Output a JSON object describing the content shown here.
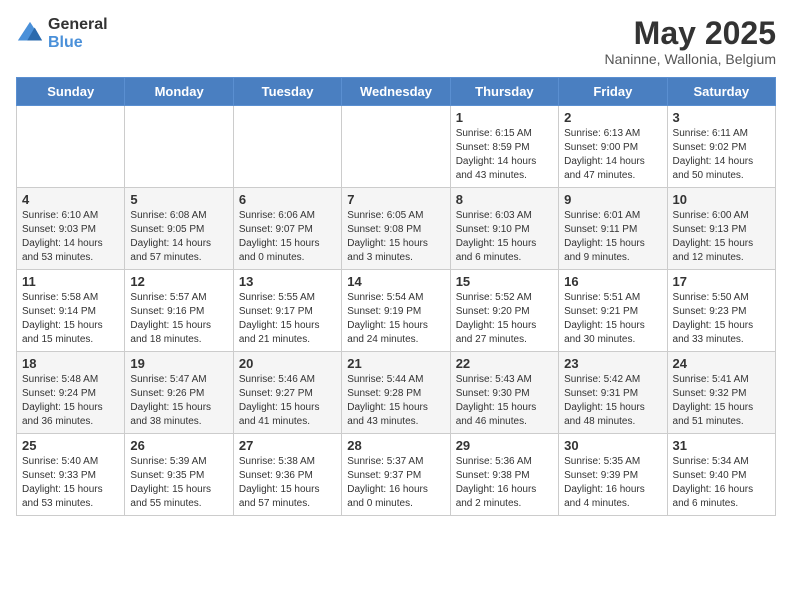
{
  "header": {
    "logo_general": "General",
    "logo_blue": "Blue",
    "title": "May 2025",
    "subtitle": "Naninne, Wallonia, Belgium"
  },
  "days_of_week": [
    "Sunday",
    "Monday",
    "Tuesday",
    "Wednesday",
    "Thursday",
    "Friday",
    "Saturday"
  ],
  "weeks": [
    [
      {
        "day": "",
        "info": ""
      },
      {
        "day": "",
        "info": ""
      },
      {
        "day": "",
        "info": ""
      },
      {
        "day": "",
        "info": ""
      },
      {
        "day": "1",
        "info": "Sunrise: 6:15 AM\nSunset: 8:59 PM\nDaylight: 14 hours\nand 43 minutes."
      },
      {
        "day": "2",
        "info": "Sunrise: 6:13 AM\nSunset: 9:00 PM\nDaylight: 14 hours\nand 47 minutes."
      },
      {
        "day": "3",
        "info": "Sunrise: 6:11 AM\nSunset: 9:02 PM\nDaylight: 14 hours\nand 50 minutes."
      }
    ],
    [
      {
        "day": "4",
        "info": "Sunrise: 6:10 AM\nSunset: 9:03 PM\nDaylight: 14 hours\nand 53 minutes."
      },
      {
        "day": "5",
        "info": "Sunrise: 6:08 AM\nSunset: 9:05 PM\nDaylight: 14 hours\nand 57 minutes."
      },
      {
        "day": "6",
        "info": "Sunrise: 6:06 AM\nSunset: 9:07 PM\nDaylight: 15 hours\nand 0 minutes."
      },
      {
        "day": "7",
        "info": "Sunrise: 6:05 AM\nSunset: 9:08 PM\nDaylight: 15 hours\nand 3 minutes."
      },
      {
        "day": "8",
        "info": "Sunrise: 6:03 AM\nSunset: 9:10 PM\nDaylight: 15 hours\nand 6 minutes."
      },
      {
        "day": "9",
        "info": "Sunrise: 6:01 AM\nSunset: 9:11 PM\nDaylight: 15 hours\nand 9 minutes."
      },
      {
        "day": "10",
        "info": "Sunrise: 6:00 AM\nSunset: 9:13 PM\nDaylight: 15 hours\nand 12 minutes."
      }
    ],
    [
      {
        "day": "11",
        "info": "Sunrise: 5:58 AM\nSunset: 9:14 PM\nDaylight: 15 hours\nand 15 minutes."
      },
      {
        "day": "12",
        "info": "Sunrise: 5:57 AM\nSunset: 9:16 PM\nDaylight: 15 hours\nand 18 minutes."
      },
      {
        "day": "13",
        "info": "Sunrise: 5:55 AM\nSunset: 9:17 PM\nDaylight: 15 hours\nand 21 minutes."
      },
      {
        "day": "14",
        "info": "Sunrise: 5:54 AM\nSunset: 9:19 PM\nDaylight: 15 hours\nand 24 minutes."
      },
      {
        "day": "15",
        "info": "Sunrise: 5:52 AM\nSunset: 9:20 PM\nDaylight: 15 hours\nand 27 minutes."
      },
      {
        "day": "16",
        "info": "Sunrise: 5:51 AM\nSunset: 9:21 PM\nDaylight: 15 hours\nand 30 minutes."
      },
      {
        "day": "17",
        "info": "Sunrise: 5:50 AM\nSunset: 9:23 PM\nDaylight: 15 hours\nand 33 minutes."
      }
    ],
    [
      {
        "day": "18",
        "info": "Sunrise: 5:48 AM\nSunset: 9:24 PM\nDaylight: 15 hours\nand 36 minutes."
      },
      {
        "day": "19",
        "info": "Sunrise: 5:47 AM\nSunset: 9:26 PM\nDaylight: 15 hours\nand 38 minutes."
      },
      {
        "day": "20",
        "info": "Sunrise: 5:46 AM\nSunset: 9:27 PM\nDaylight: 15 hours\nand 41 minutes."
      },
      {
        "day": "21",
        "info": "Sunrise: 5:44 AM\nSunset: 9:28 PM\nDaylight: 15 hours\nand 43 minutes."
      },
      {
        "day": "22",
        "info": "Sunrise: 5:43 AM\nSunset: 9:30 PM\nDaylight: 15 hours\nand 46 minutes."
      },
      {
        "day": "23",
        "info": "Sunrise: 5:42 AM\nSunset: 9:31 PM\nDaylight: 15 hours\nand 48 minutes."
      },
      {
        "day": "24",
        "info": "Sunrise: 5:41 AM\nSunset: 9:32 PM\nDaylight: 15 hours\nand 51 minutes."
      }
    ],
    [
      {
        "day": "25",
        "info": "Sunrise: 5:40 AM\nSunset: 9:33 PM\nDaylight: 15 hours\nand 53 minutes."
      },
      {
        "day": "26",
        "info": "Sunrise: 5:39 AM\nSunset: 9:35 PM\nDaylight: 15 hours\nand 55 minutes."
      },
      {
        "day": "27",
        "info": "Sunrise: 5:38 AM\nSunset: 9:36 PM\nDaylight: 15 hours\nand 57 minutes."
      },
      {
        "day": "28",
        "info": "Sunrise: 5:37 AM\nSunset: 9:37 PM\nDaylight: 16 hours\nand 0 minutes."
      },
      {
        "day": "29",
        "info": "Sunrise: 5:36 AM\nSunset: 9:38 PM\nDaylight: 16 hours\nand 2 minutes."
      },
      {
        "day": "30",
        "info": "Sunrise: 5:35 AM\nSunset: 9:39 PM\nDaylight: 16 hours\nand 4 minutes."
      },
      {
        "day": "31",
        "info": "Sunrise: 5:34 AM\nSunset: 9:40 PM\nDaylight: 16 hours\nand 6 minutes."
      }
    ]
  ]
}
